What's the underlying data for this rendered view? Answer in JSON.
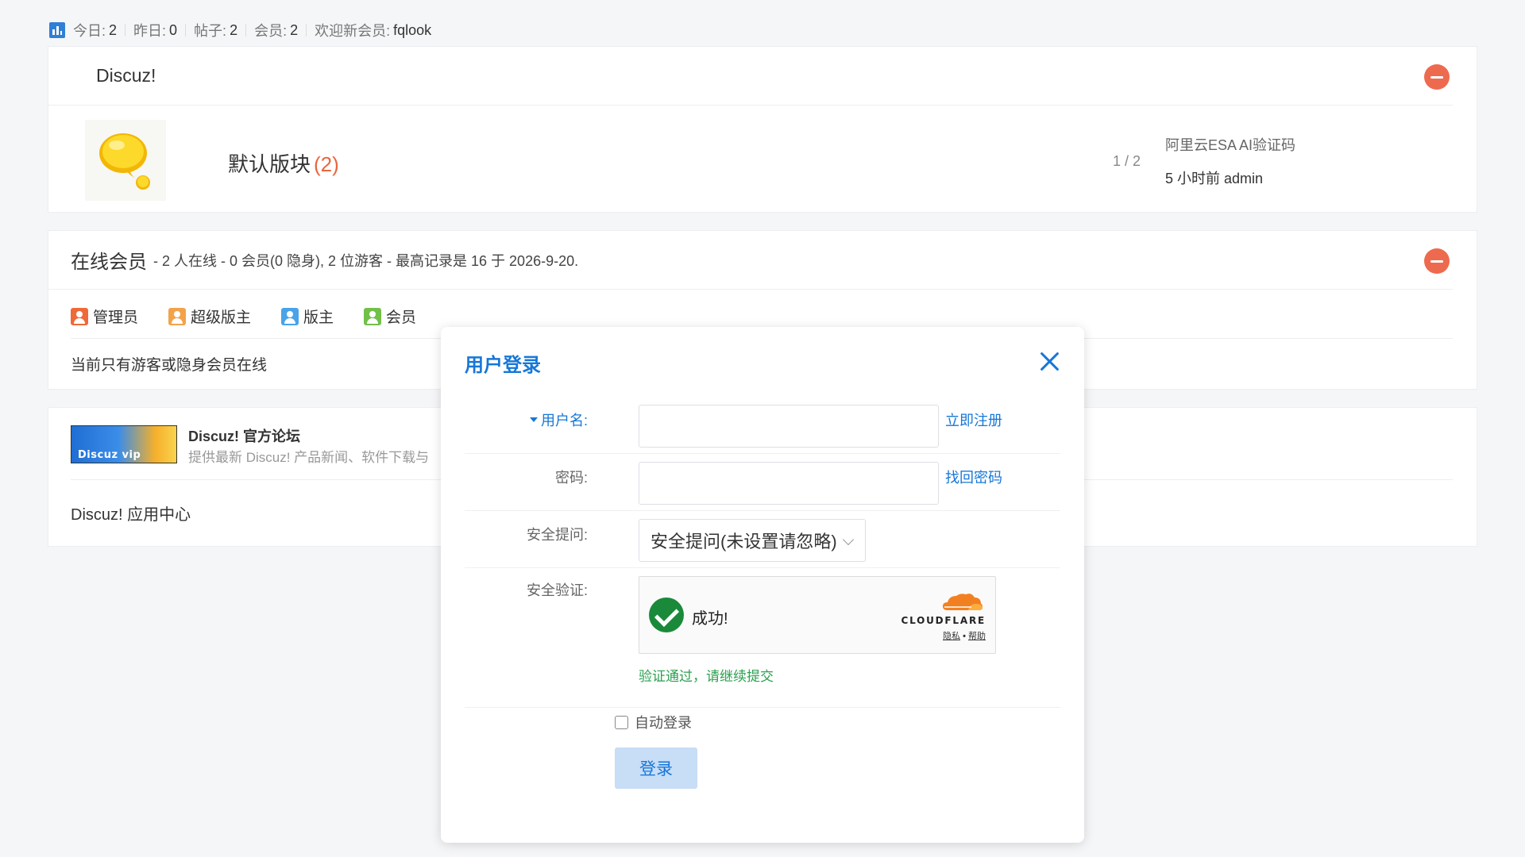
{
  "stats": {
    "today_label": "今日:",
    "today_value": "2",
    "yesterday_label": "昨日:",
    "yesterday_value": "0",
    "posts_label": "帖子:",
    "posts_value": "2",
    "members_label": "会员:",
    "members_value": "2",
    "newmember_label": "欢迎新会员:",
    "newmember_name": "fqlook"
  },
  "forum_panel": {
    "title": "Discuz!",
    "forum": {
      "name": "默认版块",
      "count": "(2)",
      "stat": "1 / 2",
      "last_post_title": "阿里云ESA AI验证码",
      "last_post_meta": "5 小时前 admin"
    }
  },
  "online_panel": {
    "title": "在线会员",
    "info": "- 2 人在线 - 0 会员(0 隐身), 2 位游客 - 最高记录是 16 于 2026-9-20.",
    "legend": [
      {
        "label": "管理员",
        "color": "#ee6a3a"
      },
      {
        "label": "超级版主",
        "color": "#f2a34a"
      },
      {
        "label": "版主",
        "color": "#4aa3e8"
      },
      {
        "label": "会员",
        "color": "#72c04a"
      }
    ],
    "empty_text": "当前只有游客或隐身会员在线"
  },
  "links_panel": {
    "logo_text": "Discuz vip",
    "title": "Discuz! 官方论坛",
    "desc": "提供最新 Discuz! 产品新闻、软件下载与",
    "app_center": "Discuz! 应用中心"
  },
  "login_modal": {
    "title": "用户登录",
    "username_label": "用户名:",
    "username_value": "",
    "register_link": "立即注册",
    "password_label": "密码:",
    "password_value": "",
    "forgot_link": "找回密码",
    "question_label": "安全提问:",
    "question_selected": "安全提问(未设置请忽略)",
    "verify_label": "安全验证:",
    "cf_success": "成功!",
    "cf_brand": "CLOUDFLARE",
    "cf_privacy": "隐私",
    "cf_dot": "•",
    "cf_help": "帮助",
    "verify_msg": "验证通过，请继续提交",
    "auto_login": "自动登录",
    "submit": "登录"
  },
  "colors": {
    "accent": "#1677d8",
    "danger": "#ee6a4e",
    "success": "#2aa14f"
  }
}
